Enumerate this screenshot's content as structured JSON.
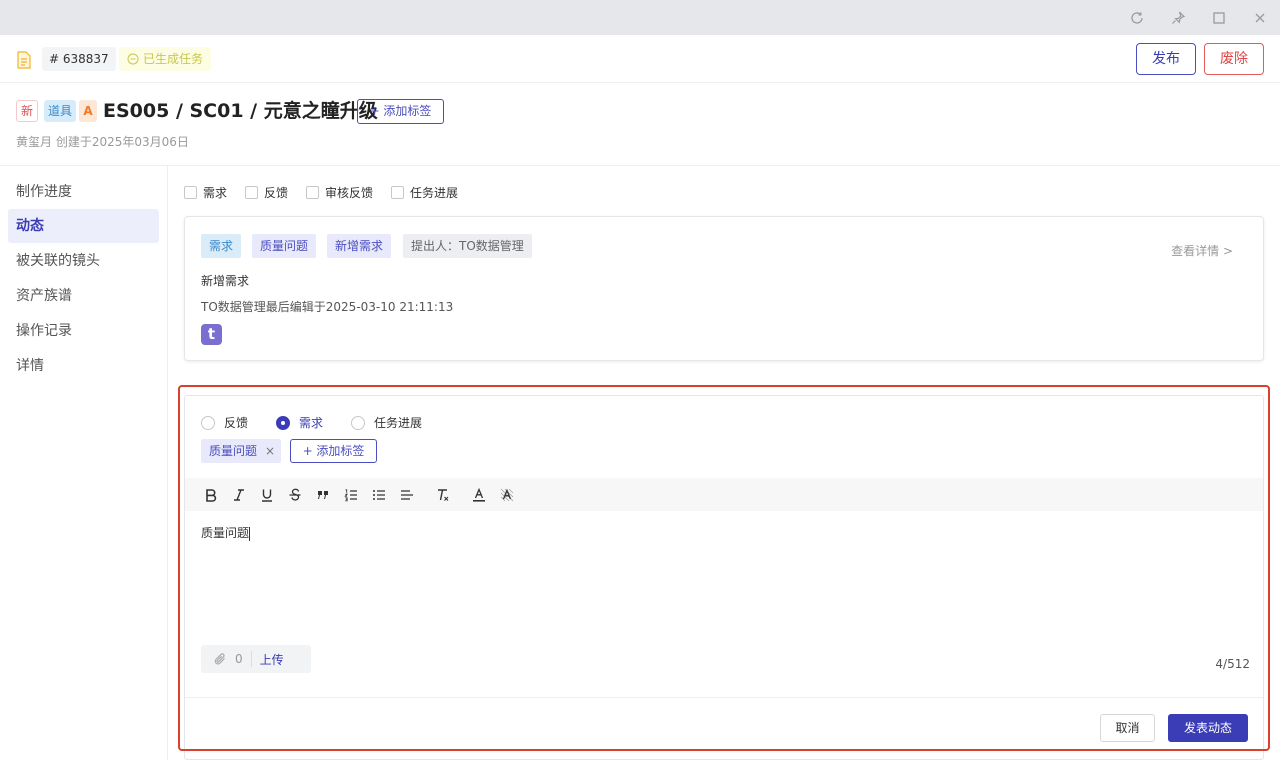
{
  "header": {
    "task_id": "# 638837",
    "generated_badge": "已生成任务",
    "publish_label": "发布",
    "discard_label": "废除"
  },
  "title": {
    "tag_new": "新",
    "tag_prop": "道具",
    "tag_grade": "A",
    "text": "ES005 / SC01 / 元意之瞳升级",
    "add_tag_label": "+ 添加标签",
    "meta": "黄玺月 创建于2025年03月06日"
  },
  "sidebar": {
    "items": [
      {
        "label": "制作进度"
      },
      {
        "label": "动态"
      },
      {
        "label": "被关联的镜头"
      },
      {
        "label": "资产族谱"
      },
      {
        "label": "操作记录"
      },
      {
        "label": "详情"
      }
    ],
    "active_index": 1
  },
  "filters": [
    {
      "label": "需求"
    },
    {
      "label": "反馈"
    },
    {
      "label": "审核反馈"
    },
    {
      "label": "任务进展"
    }
  ],
  "activity_card": {
    "tags": [
      "需求",
      "质量问题",
      "新增需求",
      "提出人：TO数据管理"
    ],
    "view_detail": "查看详情 >",
    "text": "新增需求",
    "edited": "TO数据管理最后编辑于2025-03-10 21:11:13",
    "avatar_letter": "t"
  },
  "composer": {
    "radios": [
      {
        "label": "反馈",
        "checked": false
      },
      {
        "label": "需求",
        "checked": true
      },
      {
        "label": "任务进展",
        "checked": false
      }
    ],
    "selected_tag": "质量问题",
    "remove_tag_symbol": "×",
    "add_tag_label": "+ 添加标签",
    "editor_text": "质量问题",
    "attach_count": "0",
    "upload_label": "上传",
    "char_count": "4/512",
    "cancel_label": "取消",
    "post_label": "发表动态"
  },
  "colors": {
    "accent": "#3a3db5",
    "danger": "#e04848",
    "highlight_border": "#d9412f"
  }
}
